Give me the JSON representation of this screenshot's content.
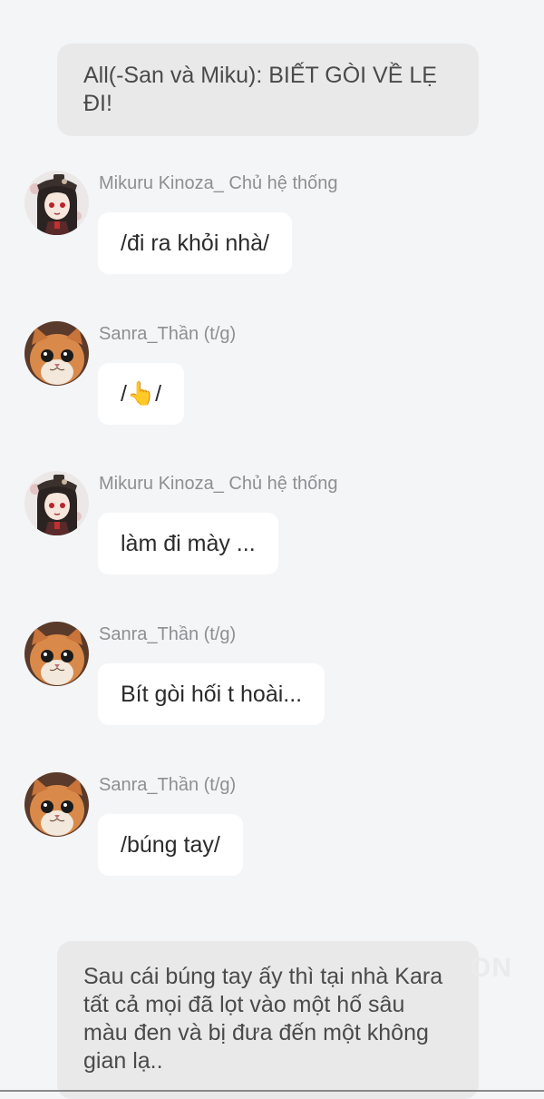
{
  "narrations": [
    {
      "text": "All(-San và Miku): BIẾT GÒI VỀ LẸ ĐI!"
    },
    {
      "text": "Sau cái búng tay ấy thì tại nhà Kara tất cả mọi đã lọt vào một hố sâu màu đen và bị đưa đến một không gian lạ.."
    }
  ],
  "messages": [
    {
      "sender": "Mikuru Kinoza_ Chủ hệ thống",
      "avatar_icon": "anime-girl-avatar-icon",
      "text": "/đi ra khỏi nhà/"
    },
    {
      "sender": "Sanra_Thần (t/g)",
      "avatar_icon": "cat-avatar-icon",
      "text": "/👆/"
    },
    {
      "sender": "Mikuru Kinoza_ Chủ hệ thống",
      "avatar_icon": "anime-girl-avatar-icon",
      "text": "làm đi mày ..."
    },
    {
      "sender": "Sanra_Thần (t/g)",
      "avatar_icon": "cat-avatar-icon",
      "text": "Bít gòi hối t hoài..."
    },
    {
      "sender": "Sanra_Thần (t/g)",
      "avatar_icon": "cat-avatar-icon",
      "text": "/búng tay/"
    }
  ],
  "watermark": "ON",
  "colors": {
    "background": "#f4f5f7",
    "narration_bubble": "#e9e9ea",
    "message_bubble": "#ffffff",
    "sender_name": "#8e8f93",
    "text": "#2b2b2b"
  }
}
